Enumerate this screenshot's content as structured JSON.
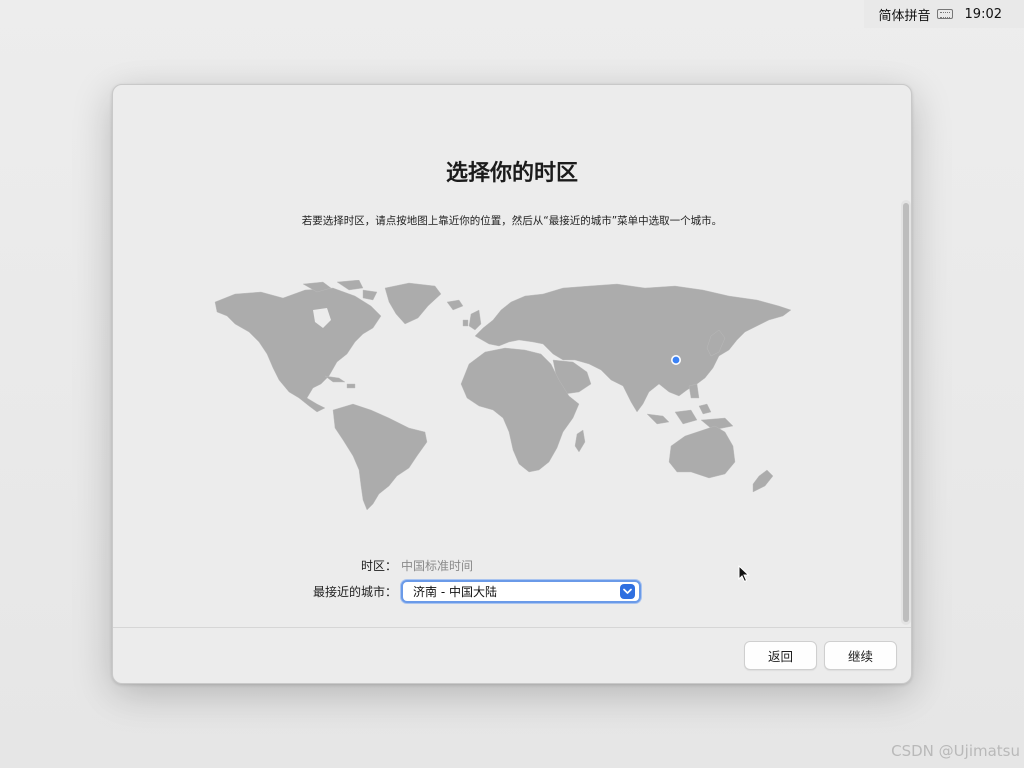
{
  "menubar": {
    "input_method": "简体拼音",
    "keyboard_icon": "keyboard-icon",
    "clock": "19:02"
  },
  "dialog": {
    "title": "选择你的时区",
    "instruction": "若要选择时区，请点按地图上靠近你的位置，然后从“最接近的城市”菜单中选取一个城市。",
    "timezone_label": "时区：",
    "timezone_value": "中国标准时间",
    "city_label": "最接近的城市：",
    "city_value": "济南 - 中国大陆",
    "back_label": "返回",
    "continue_label": "继续"
  },
  "colors": {
    "land": "#acacac",
    "accent": "#2f6fe0",
    "pin": "#3b82f6"
  },
  "watermark": "CSDN @Ujimatsu"
}
